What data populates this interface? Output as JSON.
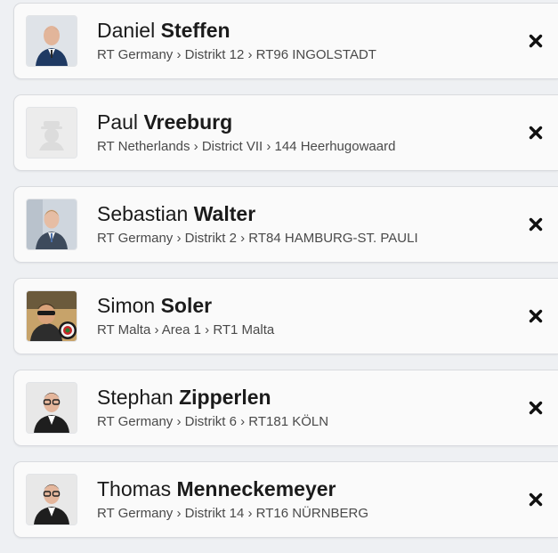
{
  "members": [
    {
      "first_name": "Daniel",
      "last_name": "Steffen",
      "path": "RT Germany › Distrikt 12 › RT96 INGOLSTADT",
      "avatar": "photo-man-suit-blue"
    },
    {
      "first_name": "Paul",
      "last_name": "Vreeburg",
      "path": "RT Netherlands › District VII › 144 Heerhugowaard",
      "avatar": "placeholder-person-icon"
    },
    {
      "first_name": "Sebastian",
      "last_name": "Walter",
      "path": "RT Germany › Distrikt 2 › RT84 HAMBURG-ST. PAULI",
      "avatar": "photo-man-suit-window"
    },
    {
      "first_name": "Simon",
      "last_name": "Soler",
      "path": "RT Malta › Area 1 › RT1 Malta",
      "avatar": "photo-man-sunglasses-dartboard"
    },
    {
      "first_name": "Stephan",
      "last_name": "Zipperlen",
      "path": "RT Germany › Distrikt 6 › RT181 KÖLN",
      "avatar": "photo-man-glasses"
    },
    {
      "first_name": "Thomas",
      "last_name": "Menneckemeyer",
      "path": "RT Germany › Distrikt 14 › RT16 NÜRNBERG",
      "avatar": "photo-man-glasses"
    }
  ],
  "remove_icon": "close-x-icon"
}
